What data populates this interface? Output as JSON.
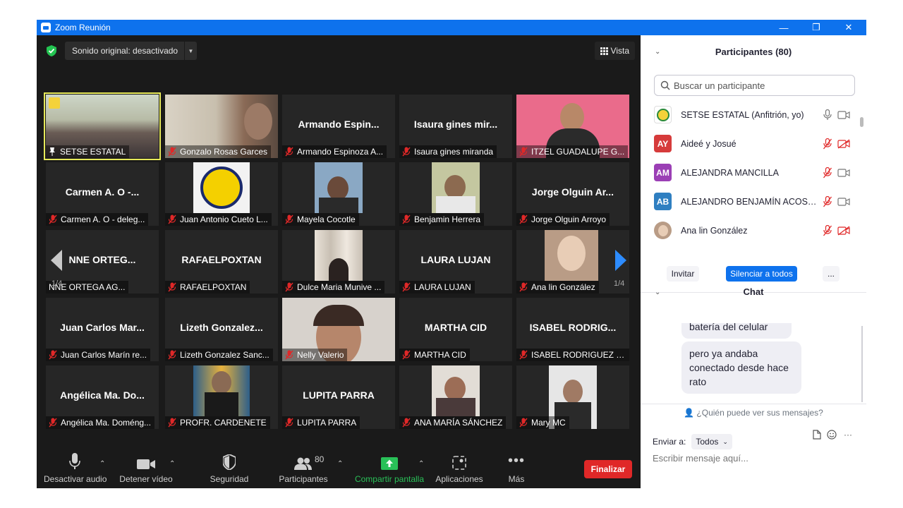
{
  "window": {
    "title": "Zoom Reunión",
    "controls": [
      "—",
      "❐",
      "✕"
    ]
  },
  "video": {
    "sound_label": "Sonido original: desactivado",
    "view_label": "Vista",
    "page_left": "1/4",
    "page_right": "1/4",
    "tiles": [
      {
        "big": "",
        "name": "SETSE ESTATAL",
        "muted": false,
        "pinned": true,
        "photo": "group"
      },
      {
        "big": "",
        "name": "Gonzalo Rosas Garces",
        "muted": true,
        "photo": "man"
      },
      {
        "big": "Armando  Espin...",
        "name": "Armando Espinoza A...",
        "muted": true
      },
      {
        "big": "Isaura gines mir...",
        "name": "Isaura gines miranda",
        "muted": true
      },
      {
        "big": "",
        "name": "ITZEL GUADALUPE G...",
        "muted": true,
        "photo": "pink"
      },
      {
        "big": "Carmen A. O -...",
        "name": "Carmen A. O -  deleg...",
        "muted": true
      },
      {
        "big": "",
        "name": "Juan Antonio Cueto L...",
        "muted": true,
        "photo": "logo"
      },
      {
        "big": "",
        "name": "Mayela Cocotle",
        "muted": true,
        "photo": "woman-sm"
      },
      {
        "big": "",
        "name": "Benjamin Herrera",
        "muted": true,
        "photo": "man-sm"
      },
      {
        "big": "Jorge Olguin Ar...",
        "name": "Jorge Olguin Arroyo",
        "muted": true
      },
      {
        "big": "NNE ORTEG...",
        "name": "NNE ORTEGA AG...",
        "muted": false
      },
      {
        "big": "RAFAELPOXTAN",
        "name": "RAFAELPOXTAN",
        "muted": true
      },
      {
        "big": "",
        "name": "Dulce Maria Munive ...",
        "muted": true,
        "photo": "curtain"
      },
      {
        "big": "LAURA LUJAN",
        "name": "LAURA LUJAN",
        "muted": true
      },
      {
        "big": "",
        "name": "Ana lin González",
        "muted": true,
        "photo": "avatar"
      },
      {
        "big": "Juan Carlos Mar...",
        "name": "Juan Carlos Marín re...",
        "muted": true
      },
      {
        "big": "Lizeth  Gonzalez...",
        "name": "Lizeth Gonzalez Sanc...",
        "muted": true
      },
      {
        "big": "",
        "name": "Nelly Valerio",
        "muted": true,
        "photo": "face"
      },
      {
        "big": "MARTHA CID",
        "name": "MARTHA CID",
        "muted": true
      },
      {
        "big": "ISABEL  RODRIG...",
        "name": "ISABEL RODRIGUEZ C...",
        "muted": true
      },
      {
        "big": "Angélica  Ma.  Do...",
        "name": "Angélica Ma. Doméng...",
        "muted": true
      },
      {
        "big": "",
        "name": "PROFR. CARDENETE",
        "muted": true,
        "photo": "suit"
      },
      {
        "big": "LUPITA PARRA",
        "name": "LUPITA PARRA",
        "muted": true
      },
      {
        "big": "",
        "name": "ANA MARÍA SÁNCHEZ",
        "muted": true,
        "photo": "older"
      },
      {
        "big": "",
        "name": "Mary MC",
        "muted": true,
        "photo": "woman-b"
      }
    ]
  },
  "toolbar": {
    "mute": "Desactivar audio",
    "video": "Detener vídeo",
    "security": "Seguridad",
    "participants": "Participantes",
    "participants_count": "80",
    "share": "Compartir pantalla",
    "apps": "Aplicaciones",
    "more": "Más",
    "end": "Finalizar"
  },
  "participants_panel": {
    "title": "Participantes (80)",
    "search_placeholder": "Buscar un participante",
    "list": [
      {
        "initials": "",
        "name": "SETSE ESTATAL (Anfitrión, yo)",
        "color": "#ffffff",
        "mic_muted": false,
        "cam_off": false
      },
      {
        "initials": "AY",
        "name": "Aideé y Josué",
        "color": "#d63b3b",
        "mic_muted": true,
        "cam_off": true
      },
      {
        "initials": "AM",
        "name": "ALEJANDRA MANCILLA",
        "color": "#9b3fb5",
        "mic_muted": true,
        "cam_off": false
      },
      {
        "initials": "AB",
        "name": "ALEJANDRO BENJAMÍN ACOST...",
        "color": "#2f7fc1",
        "mic_muted": true,
        "cam_off": false
      },
      {
        "initials": "",
        "name": "Ana lin González",
        "color": "#b88a6a",
        "mic_muted": true,
        "cam_off": true
      }
    ],
    "invite": "Invitar",
    "mute_all": "Silenciar a todos",
    "more": "..."
  },
  "chat": {
    "title": "Chat",
    "prev_message_fragment": "batería del celular",
    "message": "pero ya andaba conectado desde hace rato",
    "who_can_see": "¿Quién puede ver sus mensajes?",
    "send_to_label": "Enviar a:",
    "send_to_value": "Todos",
    "input_placeholder": "Escribir mensaje aquí..."
  },
  "colors": {
    "titlebar": "#0e72ed",
    "meeting_bg": "#1a1a1a",
    "tile_bg": "#262626",
    "active_speaker": "#e7e95a",
    "end_button": "#e02828",
    "share_green": "#29c058",
    "mute_all_blue": "#0e72ed"
  }
}
